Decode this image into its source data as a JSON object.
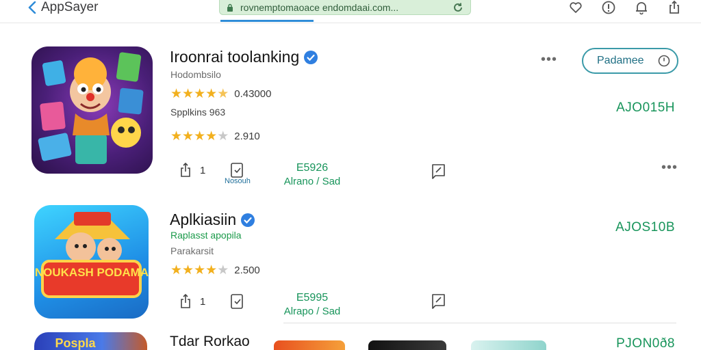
{
  "browser": {
    "back_label": "AppSayer",
    "url": "rovnemptomaoace endomdaai.com...",
    "icons": [
      "heart-icon",
      "info-icon",
      "bell-icon",
      "share-icon"
    ]
  },
  "apps": [
    {
      "title": "Iroonrai toolanking",
      "subtitle": "Hodombsilo",
      "rating1": "0.43000",
      "stars1": 4.5,
      "line2": "Spplkins 963",
      "rating2": "2.910",
      "stars2": 4.0,
      "share_count": "1",
      "save_label": "Nosouh",
      "price_top": "E5926",
      "price_bottom": "Alrano / Sad",
      "code": "AJO015H",
      "action_label": "Padamee"
    },
    {
      "title": "Aplkiasiin",
      "subtitle": "Raplasst apopila",
      "line2": "Parakarsit",
      "rating1": "2.500",
      "stars1": 4.0,
      "share_count": "1",
      "price_top": "E5995",
      "price_bottom": "Alrapo / Sad",
      "code": "AJOS10B",
      "icon_text": "NOUKASH PODAMA"
    },
    {
      "title": "Tdar Rorkao",
      "code": "PJON0ð8",
      "icon_text": "Pospla"
    }
  ],
  "colors": {
    "accent_green": "#17945a",
    "star": "#f2b01e",
    "verified_blue": "#2f7fe0",
    "url_bar": "#d9efd9"
  }
}
